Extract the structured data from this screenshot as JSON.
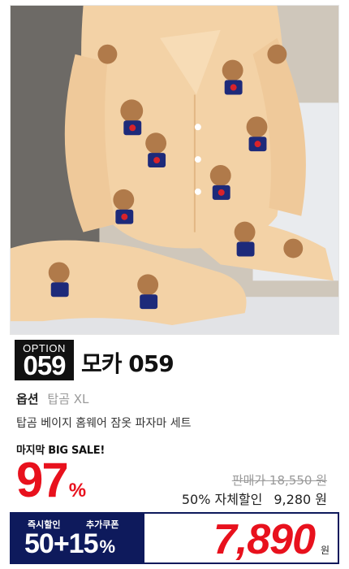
{
  "option": {
    "badge_label": "OPTION",
    "badge_number": "059",
    "title": "모카 059",
    "option_key": "옵션",
    "option_value": "탑곰 XL"
  },
  "product": {
    "description": "탑곰 베이지 홈웨어 잠옷 파자마 세트",
    "image_icon": "product-photo"
  },
  "sale": {
    "tag": "마지막 BIG SALE!",
    "percent": "97",
    "percent_sign": "%",
    "original_label": "판매가 18,550 원",
    "discount_label": "50% 자체할인",
    "discount_price": "9,280 원"
  },
  "coupon": {
    "instant_label": "즉시할인",
    "extra_label": "추가쿠폰",
    "value": "50+15",
    "sign": "%"
  },
  "final_price": {
    "value": "7,890",
    "unit": "원"
  },
  "colors": {
    "accent_red": "#e8111d",
    "navy": "#0e1a5c",
    "fabric": "#f3d2a6"
  }
}
